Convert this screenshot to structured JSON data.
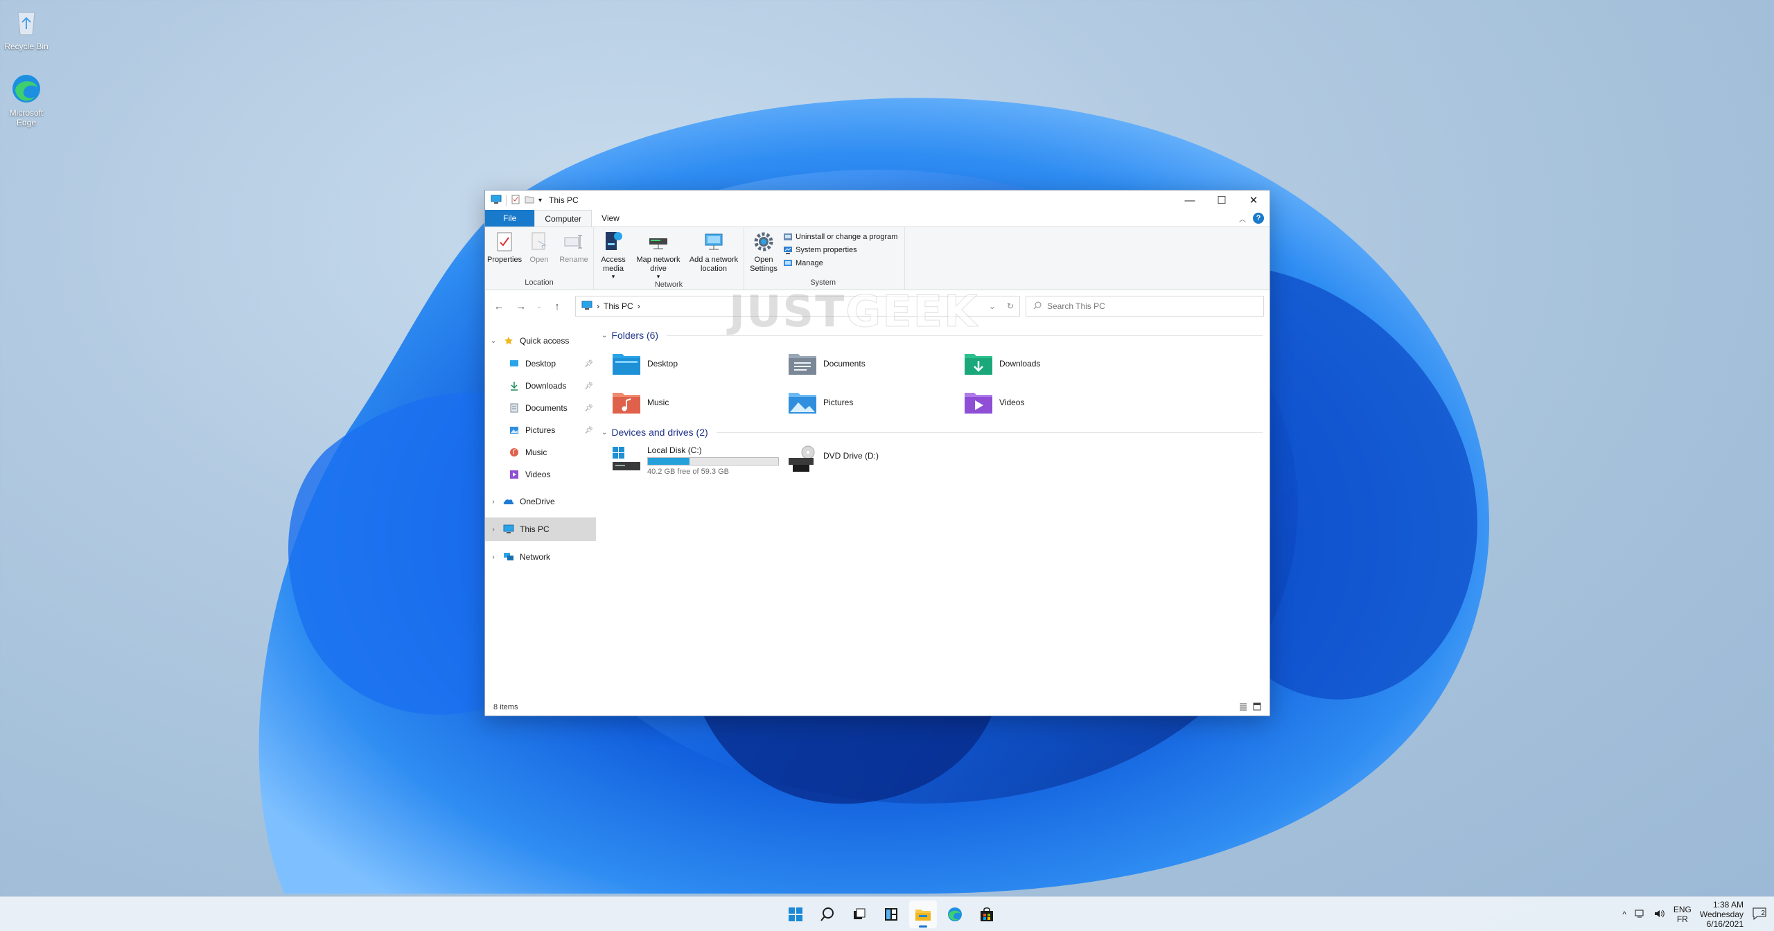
{
  "desktop": {
    "icons": [
      {
        "label": "Recycle Bin",
        "icon": "recycle-bin-icon"
      },
      {
        "label": "Microsoft Edge",
        "icon": "edge-icon"
      }
    ]
  },
  "window": {
    "title": "This PC",
    "controls": {
      "minimize": "—",
      "maximize": "☐",
      "close": "✕"
    },
    "tabs": [
      "File",
      "Computer",
      "View"
    ],
    "active_tab": "Computer"
  },
  "ribbon": {
    "location": {
      "label": "Location",
      "properties": "Properties",
      "open": "Open",
      "rename": "Rename"
    },
    "network": {
      "label": "Network",
      "access_media": "Access media",
      "access_media_arrow": "▾",
      "map_drive": "Map network drive",
      "map_drive_arrow": "▾",
      "add_location": "Add a network location"
    },
    "system": {
      "label": "System",
      "open_settings": "Open Settings",
      "uninstall": "Uninstall or change a program",
      "system_properties": "System properties",
      "manage": "Manage"
    }
  },
  "address": {
    "path": "This PC",
    "search_placeholder": "Search This PC",
    "back": "←",
    "forward": "→",
    "recent": "⌄",
    "up": "↑",
    "refresh": "↻",
    "dropdown": "⌄"
  },
  "watermark": {
    "part1": "JUST",
    "part2": "GEEK"
  },
  "navpane": {
    "quick_access": "Quick access",
    "quick_items": [
      {
        "label": "Desktop",
        "icon": "desktop-folder-icon"
      },
      {
        "label": "Downloads",
        "icon": "downloads-icon"
      },
      {
        "label": "Documents",
        "icon": "documents-icon"
      },
      {
        "label": "Pictures",
        "icon": "pictures-icon"
      },
      {
        "label": "Music",
        "icon": "music-icon"
      },
      {
        "label": "Videos",
        "icon": "videos-icon"
      }
    ],
    "onedrive": "OneDrive",
    "this_pc": "This PC",
    "network": "Network"
  },
  "content": {
    "folders_header": "Folders (6)",
    "folders": [
      {
        "label": "Desktop",
        "icon": "desktop-folder-icon",
        "color": "#1e90d6"
      },
      {
        "label": "Documents",
        "icon": "documents-folder-icon",
        "color": "#7a8797"
      },
      {
        "label": "Downloads",
        "icon": "downloads-folder-icon",
        "color": "#1aa87a"
      },
      {
        "label": "Music",
        "icon": "music-folder-icon",
        "color": "#e0614b"
      },
      {
        "label": "Pictures",
        "icon": "pictures-folder-icon",
        "color": "#2f8fde"
      },
      {
        "label": "Videos",
        "icon": "videos-folder-icon",
        "color": "#8e4fd6"
      }
    ],
    "drives_header": "Devices and drives (2)",
    "drives": [
      {
        "label": "Local Disk (C:)",
        "free": "40.2 GB free of 59.3 GB",
        "used_fraction": 0.32
      },
      {
        "label": "DVD Drive (D:)",
        "badge": "DVD"
      }
    ]
  },
  "status": {
    "items": "8 items"
  },
  "taskbar": {
    "apps": [
      "start-icon",
      "search-icon",
      "task-view-icon",
      "widgets-icon",
      "file-explorer-icon",
      "edge-icon",
      "store-icon"
    ],
    "active_app": "file-explorer-icon",
    "tray_chevron": "^",
    "lang_top": "ENG",
    "lang_bottom": "FR",
    "time": "1:38 AM",
    "day": "Wednesday",
    "date": "6/16/2021",
    "notifications": "2"
  },
  "colors": {
    "accent": "#1979ca",
    "progress": "#26a0da",
    "section_header": "#1e3287"
  }
}
